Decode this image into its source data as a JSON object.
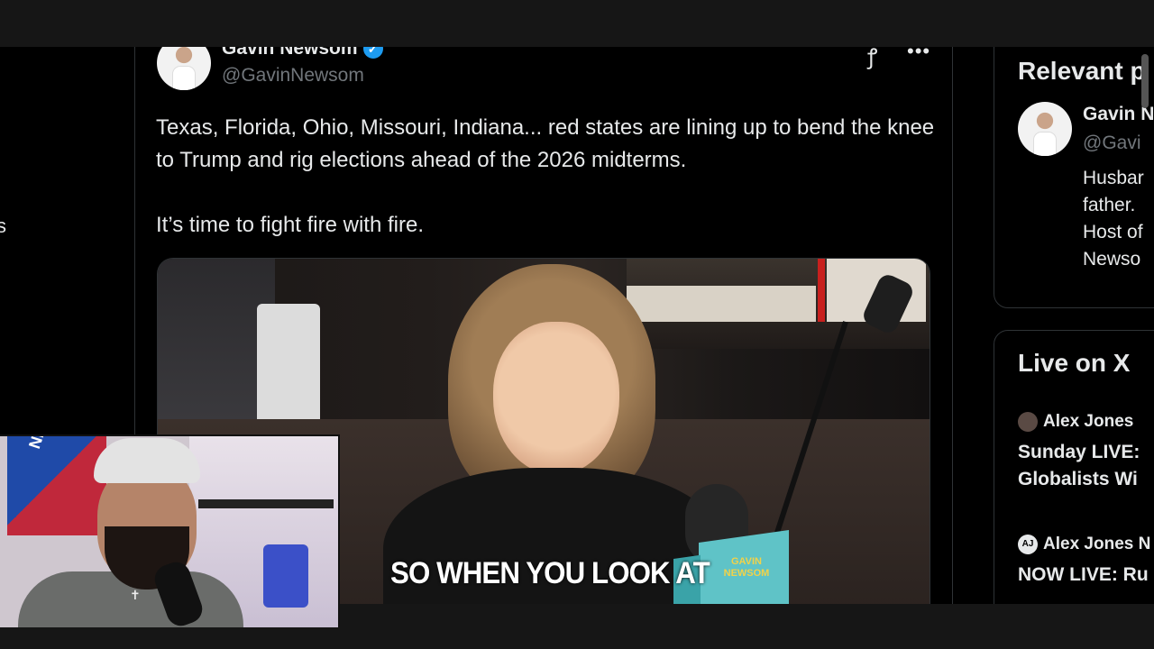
{
  "left_nav": {
    "fragment": "s"
  },
  "tweet": {
    "author_name": "Gavin Newsom",
    "handle": "@GavinNewsom",
    "verified_icon": "verified-badge-icon",
    "text_lines": [
      "Texas, Florida, Ohio, Missouri, Indiana... red states are lining up to bend the knee to Trump and rig elections ahead of the 2026 midterms.",
      "It’s time to fight fire with fire."
    ],
    "video_caption": "SO WHEN YOU LOOK AT",
    "video_cube_text": "GAVIN NEWSOM"
  },
  "right_column": {
    "relevant_title": "Relevant p",
    "relevant_name": "Gavin N",
    "relevant_handle": "@Gavi",
    "relevant_bio_lines": [
      "Husbar",
      "father.",
      "Host of",
      "Newso"
    ],
    "live_title": "Live on X",
    "live_items": [
      {
        "host": "Alex Jones",
        "title_lines": [
          "Sunday LIVE:",
          "Globalists Wi"
        ]
      },
      {
        "host": "Alex Jones N",
        "title_lines": [
          "NOW LIVE: Ru"
        ]
      }
    ]
  },
  "webcam": {
    "flag_text": "NEW YORK RANGERS"
  },
  "colors": {
    "accent": "#1d9bf0",
    "background": "#000000",
    "muted_text": "#71767b",
    "border": "#2f3336"
  }
}
